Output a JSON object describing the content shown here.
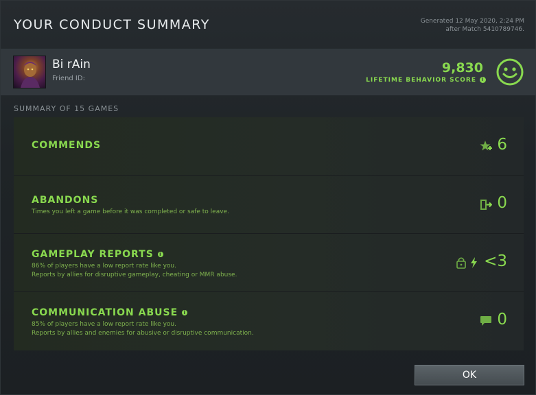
{
  "header": {
    "title": "YOUR CONDUCT SUMMARY",
    "generated_line1": "Generated 12 May 2020, 2:24 PM",
    "generated_line2": "after Match 5410789746."
  },
  "profile": {
    "name": "Bi rAin",
    "friend_id_label": "Friend ID:",
    "score_value": "9,830",
    "score_label": "LIFETIME BEHAVIOR SCORE",
    "info_glyph": "i"
  },
  "summary_label": "SUMMARY OF 15 GAMES",
  "rows": [
    {
      "title": "COMMENDS",
      "desc1": "",
      "desc2": "",
      "value": "6",
      "icon": "star-plus-icon"
    },
    {
      "title": "ABANDONS",
      "desc1": "Times you left a game before it was completed or safe to leave.",
      "desc2": "",
      "value": "0",
      "icon": "exit-door-icon"
    },
    {
      "title": "GAMEPLAY REPORTS",
      "desc1": "86% of players have a low report rate like you.",
      "desc2": "Reports by allies for disruptive gameplay, cheating or MMR abuse.",
      "value": "<3",
      "icon": "lock-lightning-icon"
    },
    {
      "title": "COMMUNICATION ABUSE",
      "desc1": "85% of players have a low report rate like you.",
      "desc2": "Reports by allies and enemies for abusive or disruptive communication.",
      "value": "0",
      "icon": "chat-bubble-icon"
    }
  ],
  "ok_label": "OK",
  "colors": {
    "accent": "#89d94f",
    "panel": "#1e2225",
    "profile_bar": "#32383d"
  }
}
